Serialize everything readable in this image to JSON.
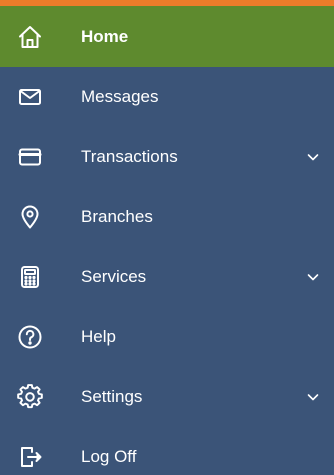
{
  "theme": {
    "accent_bar": "#ec7c2a",
    "nav_background": "#3b5478",
    "active_background": "#5e8a2e",
    "text_color": "#ffffff"
  },
  "nav": {
    "items": [
      {
        "label": "Home",
        "icon": "home-icon",
        "active": true,
        "expandable": false
      },
      {
        "label": "Messages",
        "icon": "envelope-icon",
        "active": false,
        "expandable": false
      },
      {
        "label": "Transactions",
        "icon": "card-icon",
        "active": false,
        "expandable": true
      },
      {
        "label": "Branches",
        "icon": "location-pin-icon",
        "active": false,
        "expandable": false
      },
      {
        "label": "Services",
        "icon": "calculator-icon",
        "active": false,
        "expandable": true
      },
      {
        "label": "Help",
        "icon": "help-circle-icon",
        "active": false,
        "expandable": false
      },
      {
        "label": "Settings",
        "icon": "gear-icon",
        "active": false,
        "expandable": true
      },
      {
        "label": "Log Off",
        "icon": "log-off-icon",
        "active": false,
        "expandable": false
      }
    ]
  }
}
